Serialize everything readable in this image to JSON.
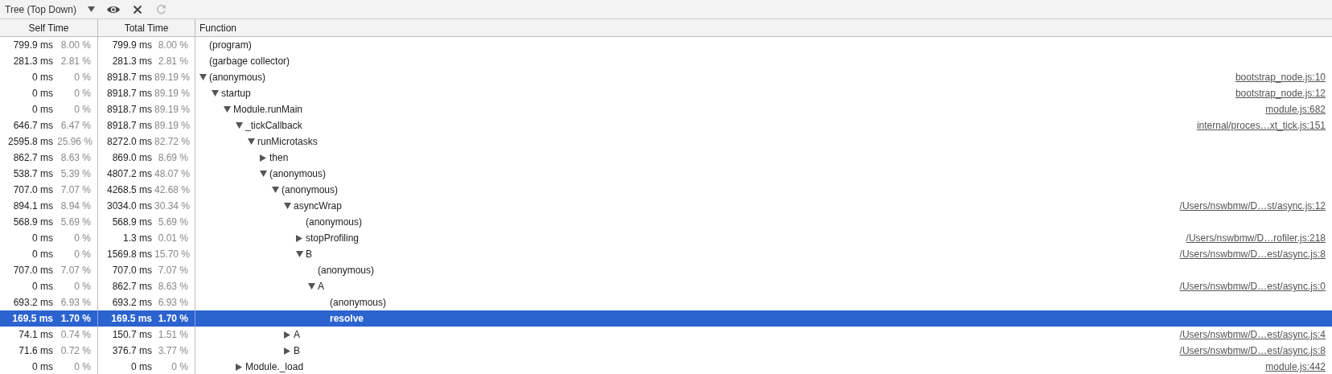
{
  "toolbar": {
    "view_mode": "Tree (Top Down)",
    "actions": [
      {
        "kind": "focus",
        "disabled": false
      },
      {
        "kind": "exclude",
        "disabled": false
      },
      {
        "kind": "restore",
        "disabled": true
      }
    ]
  },
  "table": {
    "columns": [
      "Self Time",
      "Total Time",
      "Function"
    ],
    "rows": [
      {
        "name": "(program)",
        "self_ms": "799.9 ms",
        "self_pct": "8.00 %",
        "total_ms": "799.9 ms",
        "total_pct": "8.00 %",
        "selected": false
      },
      {
        "name": "(garbage collector)",
        "self_ms": "281.3 ms",
        "self_pct": "2.81 %",
        "total_ms": "281.3 ms",
        "total_pct": "2.81 %",
        "selected": false
      },
      {
        "expanded": true,
        "name": "(anonymous)",
        "self_ms": "0 ms",
        "self_pct": "0 %",
        "total_ms": "8918.7 ms",
        "total_pct": "89.19 %",
        "url": "bootstrap_node.js:10",
        "selected": false,
        "children": [
          {
            "expanded": true,
            "name": "startup",
            "self_ms": "0 ms",
            "self_pct": "0 %",
            "total_ms": "8918.7 ms",
            "total_pct": "89.19 %",
            "url": "bootstrap_node.js:12",
            "selected": false,
            "children": [
              {
                "expanded": true,
                "name": "Module.runMain",
                "self_ms": "0 ms",
                "self_pct": "0 %",
                "total_ms": "8918.7 ms",
                "total_pct": "89.19 %",
                "url": "module.js:682",
                "selected": false,
                "children": [
                  {
                    "expanded": true,
                    "name": "_tickCallback",
                    "self_ms": "646.7 ms",
                    "self_pct": "6.47 %",
                    "total_ms": "8918.7 ms",
                    "total_pct": "89.19 %",
                    "url": "internal/proces…xt_tick.js:151",
                    "selected": false,
                    "children": [
                      {
                        "expanded": true,
                        "name": "runMicrotasks",
                        "self_ms": "2595.8 ms",
                        "self_pct": "25.96 %",
                        "total_ms": "8272.0 ms",
                        "total_pct": "82.72 %",
                        "selected": false,
                        "children": [
                          {
                            "expanded": false,
                            "name": "then",
                            "self_ms": "862.7 ms",
                            "self_pct": "8.63 %",
                            "total_ms": "869.0 ms",
                            "total_pct": "8.69 %",
                            "selected": false
                          },
                          {
                            "expanded": true,
                            "name": "(anonymous)",
                            "self_ms": "538.7 ms",
                            "self_pct": "5.39 %",
                            "total_ms": "4807.2 ms",
                            "total_pct": "48.07 %",
                            "selected": false,
                            "children": [
                              {
                                "expanded": true,
                                "name": "(anonymous)",
                                "self_ms": "707.0 ms",
                                "self_pct": "7.07 %",
                                "total_ms": "4268.5 ms",
                                "total_pct": "42.68 %",
                                "selected": false,
                                "children": [
                                  {
                                    "expanded": true,
                                    "name": "asyncWrap",
                                    "self_ms": "894.1 ms",
                                    "self_pct": "8.94 %",
                                    "total_ms": "3034.0 ms",
                                    "total_pct": "30.34 %",
                                    "url": "/Users/nswbmw/D…st/async.js:12",
                                    "selected": false,
                                    "children": [
                                      {
                                        "name": "(anonymous)",
                                        "self_ms": "568.9 ms",
                                        "self_pct": "5.69 %",
                                        "total_ms": "568.9 ms",
                                        "total_pct": "5.69 %",
                                        "selected": false
                                      },
                                      {
                                        "expanded": false,
                                        "name": "stopProfiling",
                                        "self_ms": "0 ms",
                                        "self_pct": "0 %",
                                        "total_ms": "1.3 ms",
                                        "total_pct": "0.01 %",
                                        "url": "/Users/nswbmw/D…rofiler.js:218",
                                        "selected": false
                                      },
                                      {
                                        "expanded": true,
                                        "name": "B",
                                        "self_ms": "0 ms",
                                        "self_pct": "0 %",
                                        "total_ms": "1569.8 ms",
                                        "total_pct": "15.70 %",
                                        "url": "/Users/nswbmw/D…est/async.js:8",
                                        "selected": false,
                                        "children": [
                                          {
                                            "name": "(anonymous)",
                                            "self_ms": "707.0 ms",
                                            "self_pct": "7.07 %",
                                            "total_ms": "707.0 ms",
                                            "total_pct": "7.07 %",
                                            "selected": false
                                          },
                                          {
                                            "expanded": true,
                                            "name": "A",
                                            "self_ms": "0 ms",
                                            "self_pct": "0 %",
                                            "total_ms": "862.7 ms",
                                            "total_pct": "8.63 %",
                                            "url": "/Users/nswbmw/D…est/async.js:0",
                                            "selected": false,
                                            "children": [
                                              {
                                                "name": "(anonymous)",
                                                "self_ms": "693.2 ms",
                                                "self_pct": "6.93 %",
                                                "total_ms": "693.2 ms",
                                                "total_pct": "6.93 %",
                                                "selected": false
                                              },
                                              {
                                                "name": "resolve",
                                                "self_ms": "169.5 ms",
                                                "self_pct": "1.70 %",
                                                "total_ms": "169.5 ms",
                                                "total_pct": "1.70 %",
                                                "selected": true
                                              }
                                            ]
                                          }
                                        ]
                                      }
                                    ]
                                  },
                                  {
                                    "expanded": false,
                                    "name": "A",
                                    "self_ms": "74.1 ms",
                                    "self_pct": "0.74 %",
                                    "total_ms": "150.7 ms",
                                    "total_pct": "1.51 %",
                                    "url": "/Users/nswbmw/D…est/async.js:4",
                                    "selected": false
                                  },
                                  {
                                    "expanded": false,
                                    "name": "B",
                                    "self_ms": "71.6 ms",
                                    "self_pct": "0.72 %",
                                    "total_ms": "376.7 ms",
                                    "total_pct": "3.77 %",
                                    "url": "/Users/nswbmw/D…est/async.js:8",
                                    "selected": false
                                  }
                                ]
                              }
                            ]
                          }
                        ]
                      }
                    ]
                  },
                  {
                    "expanded": false,
                    "name": "Module._load",
                    "self_ms": "0 ms",
                    "self_pct": "0 %",
                    "total_ms": "0 ms",
                    "total_pct": "0 %",
                    "url": "module.js:442",
                    "selected": false
                  }
                ]
              }
            ]
          }
        ]
      }
    ]
  }
}
